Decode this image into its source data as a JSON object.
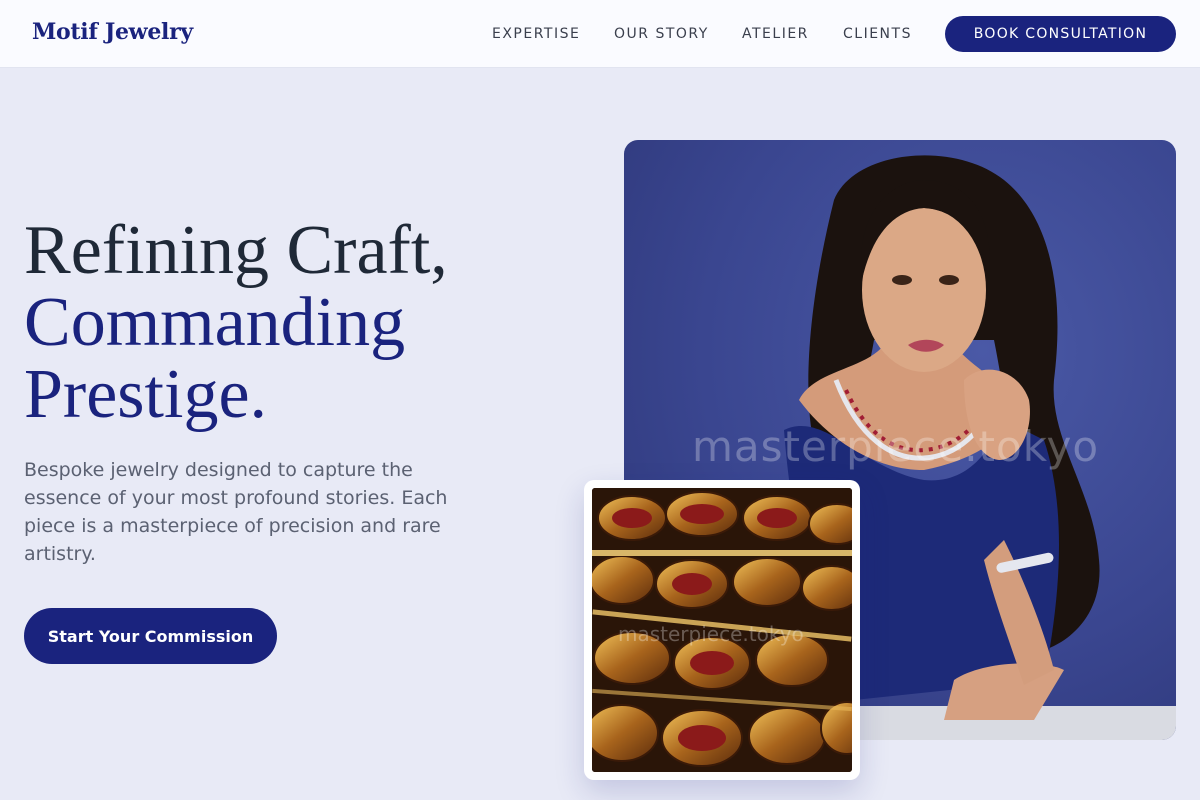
{
  "header": {
    "logo": "Motif Jewelry",
    "nav": [
      "EXPERTISE",
      "OUR STORY",
      "ATELIER",
      "CLIENTS"
    ],
    "cta_label": "BOOK CONSULTATION"
  },
  "hero": {
    "headline_line1": "Refining Craft,",
    "headline_line2": "Commanding",
    "headline_line3": "Prestige.",
    "subtext": "Bespoke jewelry designed to capture the essence of your most profound stories. Each piece is a masterpiece of precision and rare artistry.",
    "cta_label": "Start Your Commission"
  },
  "images": {
    "portrait_watermark": "masterpiece.tokyo",
    "bangles_watermark": "masterpiece.tokyo"
  },
  "colors": {
    "brand": "#1a237e",
    "page_background": "#e8eaf6",
    "header_background": "#fafbff"
  }
}
